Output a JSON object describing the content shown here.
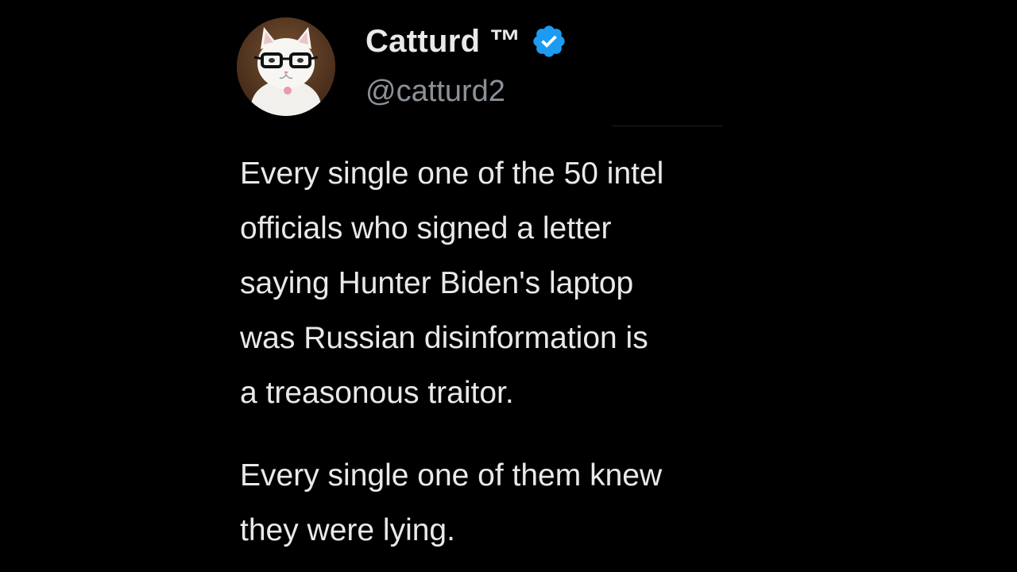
{
  "tweet": {
    "author": {
      "display_name": "Catturd ™",
      "handle": "@catturd2",
      "verified": true,
      "verified_color": "#1d9bf0",
      "avatar_icon": "cat-with-glasses-avatar"
    },
    "paragraphs": [
      {
        "lines": [
          "Every single one of the 50 intel",
          "officials who signed a letter",
          "saying Hunter Biden's laptop",
          "was Russian disinformation is",
          "a treasonous traitor."
        ]
      },
      {
        "lines": [
          "Every single one of them knew",
          "they were lying."
        ]
      }
    ]
  },
  "colors": {
    "background": "#000000",
    "text": "#e7e9ea",
    "secondary_text": "#8b9196"
  }
}
